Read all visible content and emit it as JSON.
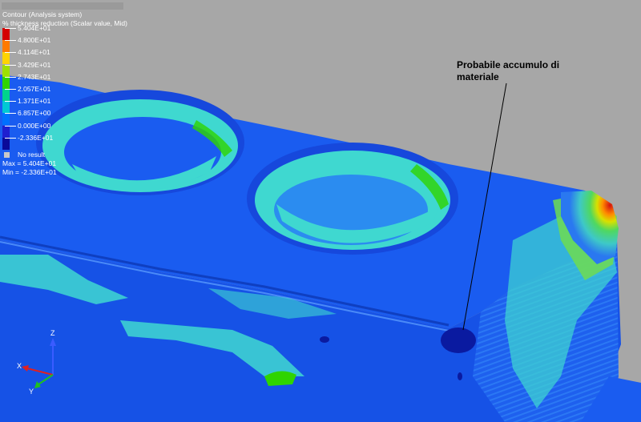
{
  "legend": {
    "title": "Contour (Analysis system)",
    "subtitle": "% thickness reduction (Scalar value, Mid)",
    "levels": [
      {
        "label": "5.404E+01",
        "color": "#d40000"
      },
      {
        "label": "4.800E+01",
        "color": "#ff7a00"
      },
      {
        "label": "4.114E+01",
        "color": "#ffd400"
      },
      {
        "label": "3.429E+01",
        "color": "#9ee000"
      },
      {
        "label": "2.743E+01",
        "color": "#2fd400"
      },
      {
        "label": "2.057E+01",
        "color": "#00d48c"
      },
      {
        "label": "1.371E+01",
        "color": "#00c8d4"
      },
      {
        "label": "6.857E+00",
        "color": "#0070ff"
      },
      {
        "label": "0.000E+00",
        "color": "#1f1fd0"
      },
      {
        "label": "-2.336E+01",
        "color": "#0a0a9a"
      }
    ],
    "no_result": "No result",
    "max": "Max = 5.404E+01",
    "min": "Min = -2.336E+01"
  },
  "annotation": {
    "line1": "Probabile accumulo di",
    "line2": "materiale"
  },
  "axes": {
    "z": "Z",
    "x": "X",
    "y": "Y"
  },
  "colors": {
    "background": "#a7a7a7",
    "surface_blue": "#1a5cf0",
    "light_cyan": "#3fd8d0",
    "green": "#2fd400",
    "red": "#e01010",
    "deep_blue": "#0a1aa0"
  }
}
